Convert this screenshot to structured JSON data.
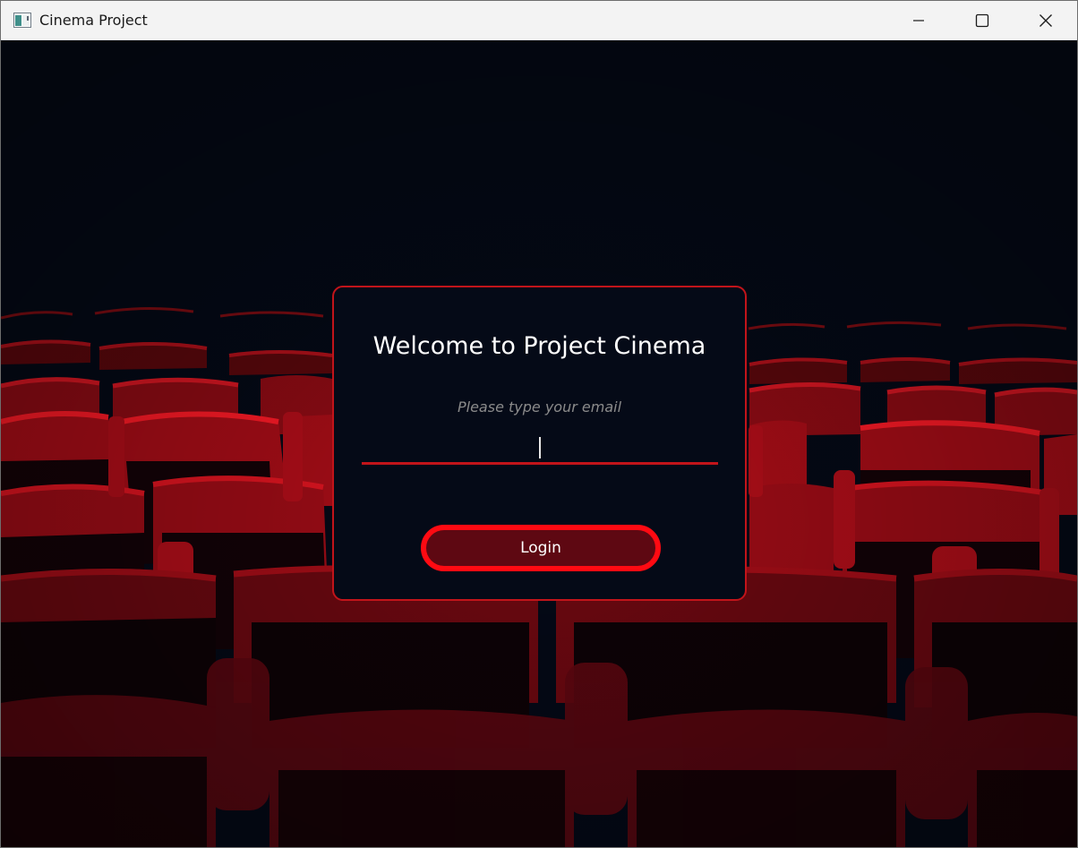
{
  "window": {
    "title": "Cinema Project",
    "app_icon": "app-window-icon",
    "controls": {
      "minimize_icon": "minimize-icon",
      "maximize_icon": "maximize-icon",
      "close_icon": "close-icon"
    }
  },
  "background": {
    "image": "red-theater-seats",
    "base_color": "#040916",
    "seat_color": "#c3121c"
  },
  "login": {
    "title": "Welcome to Project Cinema",
    "email_label": "Please type your email",
    "email_value": "",
    "button_label": "Login",
    "accent_color": "#c2141a",
    "button_fill": "#5e0812"
  }
}
